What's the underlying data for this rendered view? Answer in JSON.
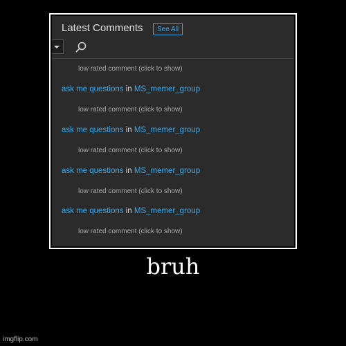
{
  "screenshot": {
    "header": {
      "title": "Latest Comments",
      "see_all_label": "See All"
    },
    "toolbar": {
      "dropdown_icon": "chevron-down-icon",
      "search_icon": "search-icon"
    },
    "rows": [
      {
        "type": "low",
        "text": "low rated comment (click to show)"
      },
      {
        "type": "comment",
        "title": "ask me questions",
        "in": "in",
        "group": "MS_memer_group"
      },
      {
        "type": "low",
        "text": "low rated comment (click to show)"
      },
      {
        "type": "comment",
        "title": "ask me questions",
        "in": "in",
        "group": "MS_memer_group"
      },
      {
        "type": "low",
        "text": "low rated comment (click to show)"
      },
      {
        "type": "comment",
        "title": "ask me questions",
        "in": "in",
        "group": "MS_memer_group"
      },
      {
        "type": "low",
        "text": "low rated comment (click to show)"
      },
      {
        "type": "comment",
        "title": "ask me questions",
        "in": "in",
        "group": "MS_memer_group"
      },
      {
        "type": "low",
        "text": "low rated comment (click to show)"
      }
    ]
  },
  "caption": "bruh",
  "watermark": "imgflip.com",
  "colors": {
    "background": "#000000",
    "panel": "#2b2b2b",
    "link": "#39a9ec",
    "muted_text": "#a8a8a8"
  }
}
